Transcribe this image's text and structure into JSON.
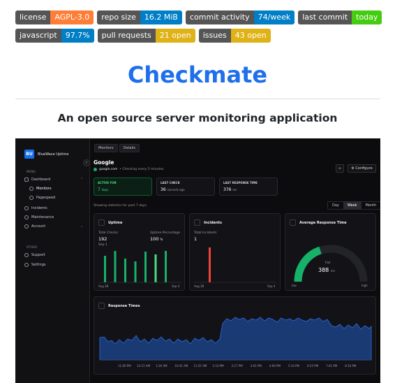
{
  "badges": [
    [
      {
        "label": "license",
        "value": "AGPL-3.0",
        "color": "#fe7d37"
      },
      {
        "label": "repo size",
        "value": "16.2 MiB",
        "color": "#007ec6"
      },
      {
        "label": "commit activity",
        "value": "74/week",
        "color": "#007ec6"
      },
      {
        "label": "last commit",
        "value": "today",
        "color": "#44cc11"
      }
    ],
    [
      {
        "label": "javascript",
        "value": "97.7%",
        "color": "#007ec6"
      },
      {
        "label": "pull requests",
        "value": "21 open",
        "color": "#dfb317"
      },
      {
        "label": "issues",
        "value": "43 open",
        "color": "#dfb317"
      }
    ]
  ],
  "title": "Checkmate",
  "subtitle": "An open source server monitoring application",
  "app": {
    "logo_mark": "BU",
    "logo_name": "BlueWave Uptime",
    "sidebar": {
      "menu_label": "MENU",
      "other_label": "OTHER",
      "items": [
        {
          "label": "Dashboard",
          "icon": "home-icon"
        },
        {
          "label": "Monitors",
          "icon": "globe-icon"
        },
        {
          "label": "Pagespeed",
          "icon": "gauge-icon"
        },
        {
          "label": "Incidents",
          "icon": "alert-icon"
        },
        {
          "label": "Maintenance",
          "icon": "wrench-icon"
        },
        {
          "label": "Account",
          "icon": "user-icon"
        },
        {
          "label": "Support",
          "icon": "support-icon"
        },
        {
          "label": "Settings",
          "icon": "gear-icon"
        }
      ]
    },
    "breadcrumb": [
      "Monitors",
      "Details"
    ],
    "monitor": {
      "name": "Google",
      "url": "google.com",
      "check_text": "• Checking every 5 minutes."
    },
    "configure_label": "Configure",
    "stats": [
      {
        "key": "ACTIVE FOR",
        "value": "7",
        "unit": "days"
      },
      {
        "key": "LAST CHECK",
        "value": "36",
        "unit": "seconds ago"
      },
      {
        "key": "LAST RESPONSE TIME",
        "value": "376",
        "unit": "ms"
      }
    ],
    "showing_text": "Showing statistics for past 7 days.",
    "ranges": [
      "Day",
      "Week",
      "Month"
    ],
    "selected_range": "Week",
    "uptime_card": {
      "title": "Uptime",
      "total_checks_label": "Total Checks",
      "total_checks": "192",
      "total_checks_sub": "Sep 1",
      "uptime_pct_label": "Uptime Percentage",
      "uptime_pct": "100",
      "uptime_pct_unit": "%",
      "date_start": "Aug 28",
      "date_end": "Sep 4",
      "bars": [
        38,
        45,
        34,
        30,
        44,
        40,
        45
      ]
    },
    "incidents_card": {
      "title": "Incidents",
      "total_label": "Total Incidents",
      "total": "1",
      "date_start": "Aug 28",
      "date_end": "Sep 4"
    },
    "response_card": {
      "title": "Average Response Time",
      "gauge_label": "Fair",
      "gauge_value": "388",
      "gauge_unit": "ms",
      "low": "low",
      "high": "high"
    },
    "response_times": {
      "title": "Response Times",
      "ticks": [
        "11:00 PM",
        "12:15 AM",
        "1:26 AM",
        "10:41 AM",
        "11:55 AM",
        "1:10 PM",
        "2:17 PM",
        "3:01 PM",
        "4:00 PM",
        "5:10 PM",
        "6:25 PM",
        "7:41 PM",
        "8:16 PM"
      ]
    }
  },
  "colors": {
    "green": "#17b26a",
    "red": "#f04438",
    "blue": "#1570ef"
  }
}
